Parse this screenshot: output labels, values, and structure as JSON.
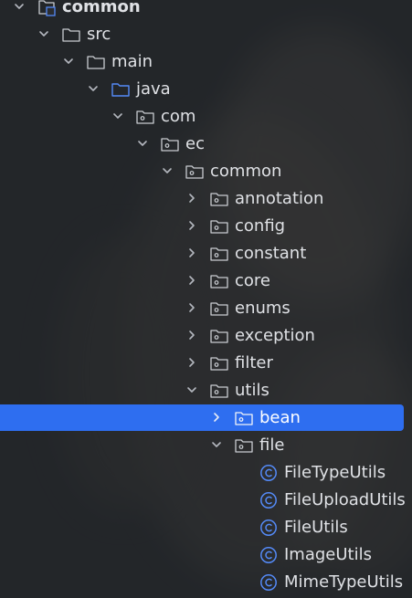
{
  "project_tree": {
    "selected": "bean",
    "rows": [
      {
        "label": "common",
        "kind": "module",
        "expanded": true
      },
      {
        "label": "src",
        "kind": "folder",
        "expanded": true
      },
      {
        "label": "main",
        "kind": "folder",
        "expanded": true
      },
      {
        "label": "java",
        "kind": "source-root",
        "expanded": true
      },
      {
        "label": "com",
        "kind": "package",
        "expanded": true
      },
      {
        "label": "ec",
        "kind": "package",
        "expanded": true
      },
      {
        "label": "common",
        "kind": "package",
        "expanded": true
      },
      {
        "label": "annotation",
        "kind": "package",
        "expanded": false
      },
      {
        "label": "config",
        "kind": "package",
        "expanded": false
      },
      {
        "label": "constant",
        "kind": "package",
        "expanded": false
      },
      {
        "label": "core",
        "kind": "package",
        "expanded": false
      },
      {
        "label": "enums",
        "kind": "package",
        "expanded": false
      },
      {
        "label": "exception",
        "kind": "package",
        "expanded": false
      },
      {
        "label": "filter",
        "kind": "package",
        "expanded": false
      },
      {
        "label": "utils",
        "kind": "package",
        "expanded": true
      },
      {
        "label": "bean",
        "kind": "package",
        "expanded": false
      },
      {
        "label": "file",
        "kind": "package",
        "expanded": true
      },
      {
        "label": "FileTypeUtils",
        "kind": "class"
      },
      {
        "label": "FileUploadUtils",
        "kind": "class"
      },
      {
        "label": "FileUtils",
        "kind": "class"
      },
      {
        "label": "ImageUtils",
        "kind": "class"
      },
      {
        "label": "MimeTypeUtils",
        "kind": "class"
      }
    ]
  },
  "colors": {
    "background": "#2b2d30",
    "selection": "#2e6ef0",
    "text": "#dfe1e5",
    "chevron": "#b4b8bf",
    "folder_icon": "#c9ccd1",
    "source_root_icon": "#548af7",
    "class_icon": "#548af7"
  }
}
